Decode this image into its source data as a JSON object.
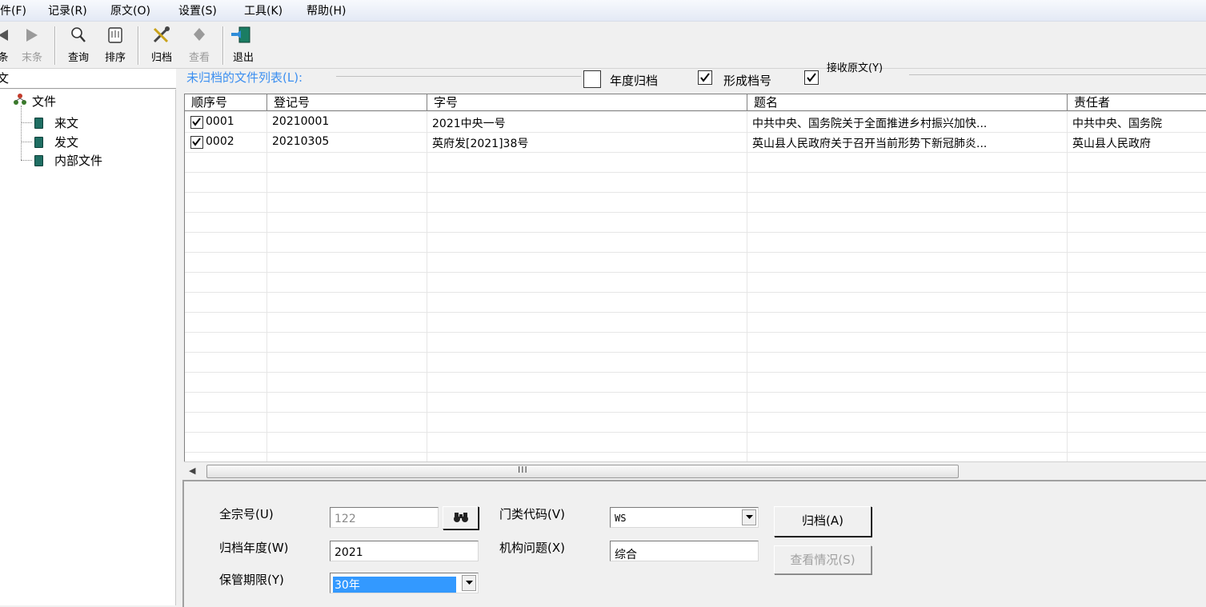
{
  "menu": [
    "件(F)",
    "记录(R)",
    "原文(O)",
    "设置(S)",
    "工具(K)",
    "帮助(H)"
  ],
  "toolbar": {
    "prev_label": "条",
    "last_label": "末条",
    "query_label": "查询",
    "sort_label": "排序",
    "archive_label": "归档",
    "view_label": "查看",
    "exit_label": "退出"
  },
  "tree": {
    "header": "文",
    "root": "文件",
    "children": [
      "来文",
      "发文",
      "内部文件"
    ]
  },
  "list": {
    "title": "未归档的文件列表(L):",
    "options": [
      {
        "label": "年度归档",
        "checked": false
      },
      {
        "label": "形成档号",
        "checked": true
      },
      {
        "label": "接收原文(Y)",
        "checked": true
      }
    ],
    "columns": [
      "顺序号",
      "登记号",
      "字号",
      "题名",
      "责任者"
    ],
    "rows": [
      {
        "seq": "0001",
        "reg": "20210001",
        "doc_no": "2021中央一号",
        "title": "中共中央、国务院关于全面推进乡村振兴加快...",
        "owner": "中共中央、国务院",
        "checked": true
      },
      {
        "seq": "0002",
        "reg": "20210305",
        "doc_no": "英府发[2021]38号",
        "title": "英山县人民政府关于召开当前形势下新冠肺炎...",
        "owner": "英山县人民政府",
        "checked": true
      }
    ],
    "scroll_grip": "III"
  },
  "form": {
    "fonds_label": "全宗号(U)",
    "fonds_value": "122",
    "category_label": "门类代码(V)",
    "category_value": "WS",
    "year_label": "归档年度(W)",
    "year_value": "2021",
    "org_label": "机构问题(X)",
    "org_value": "综合",
    "retention_label": "保管期限(Y)",
    "retention_value": "30年",
    "archive_button": "归档(A)",
    "status_button": "查看情况(S)"
  }
}
